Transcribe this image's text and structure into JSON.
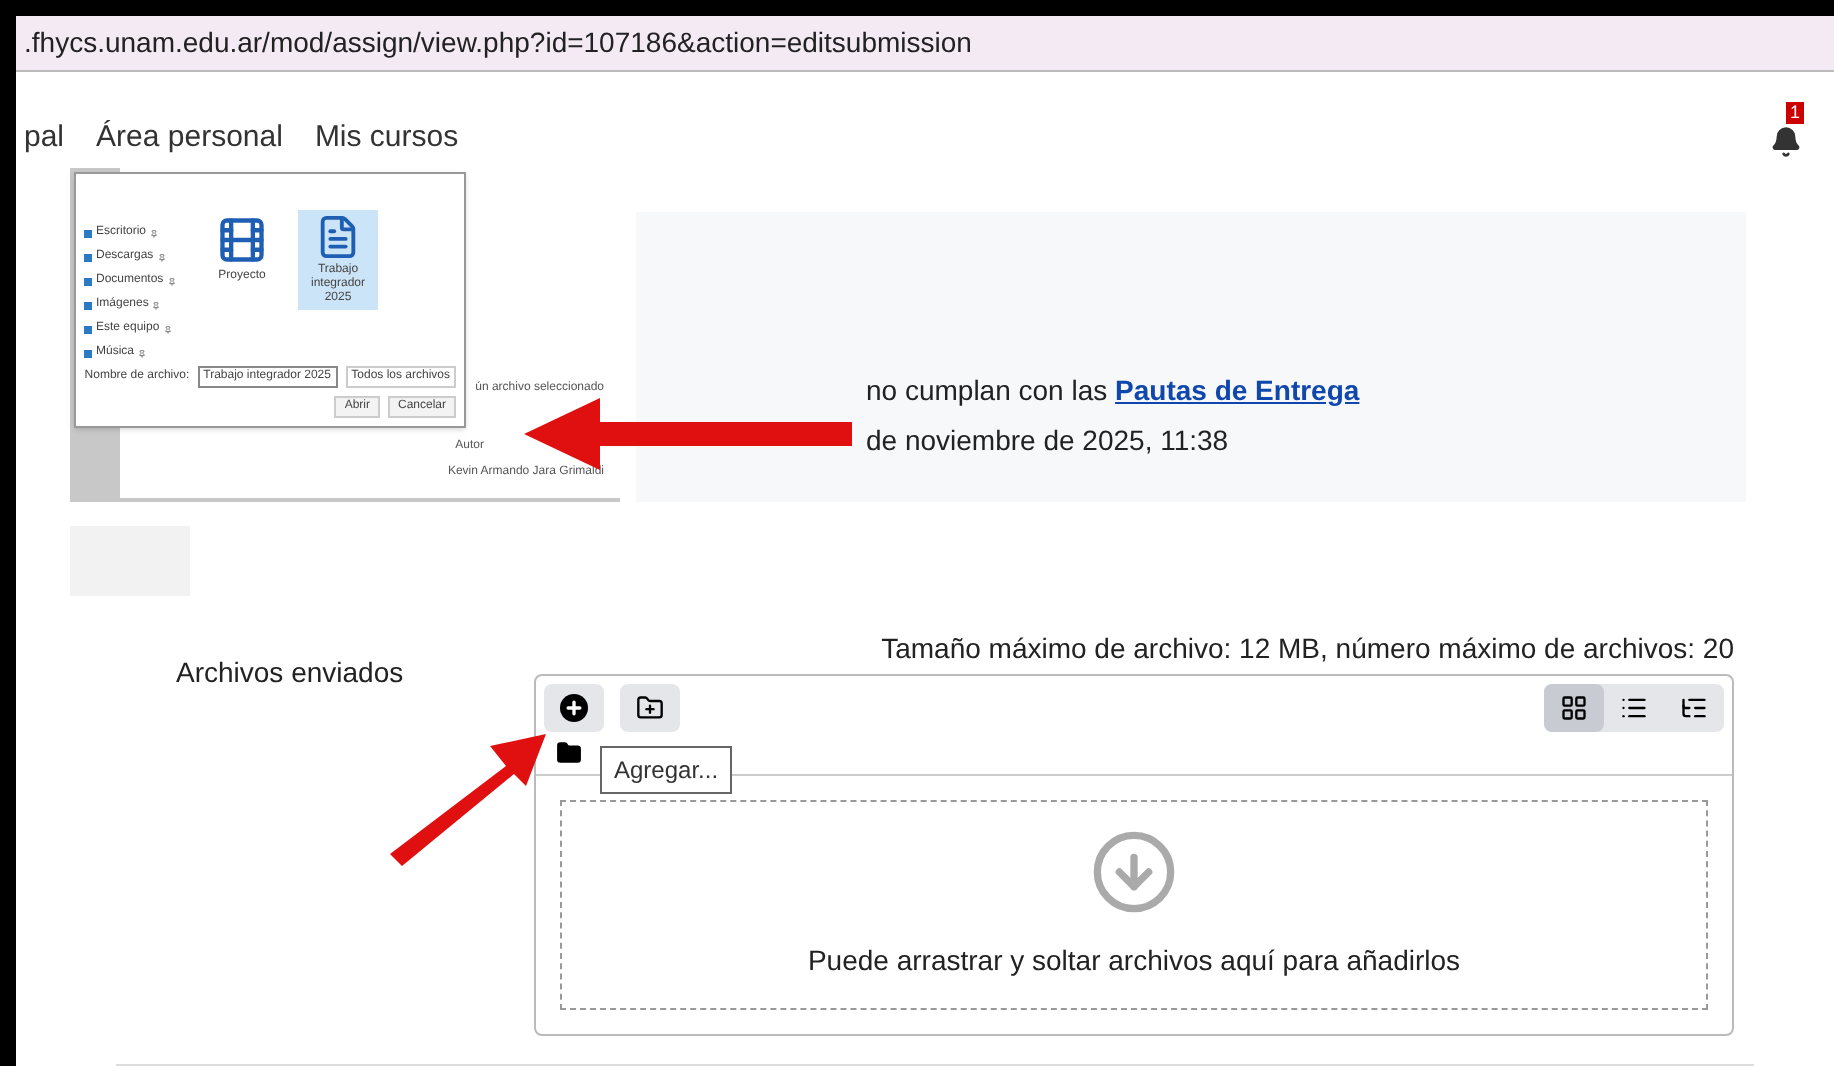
{
  "address_bar": {
    "url": ".fhycs.unam.edu.ar/mod/assign/view.php?id=107186&action=editsubmission"
  },
  "nav": {
    "items": [
      "pal",
      "Área personal",
      "Mis cursos"
    ],
    "notifications": "1"
  },
  "file_dialog": {
    "sidebar": [
      "Escritorio",
      "Descargas",
      "Documentos",
      "Imágenes",
      "Este equipo",
      "Música"
    ],
    "files": [
      {
        "kind": "video",
        "name": "Proyecto",
        "selected": false
      },
      {
        "kind": "word",
        "name": "Trabajo integrador 2025",
        "selected": true
      }
    ],
    "filename_label": "Nombre de archivo:",
    "filename": "Trabajo integrador 2025",
    "filter": "Todos los archivos",
    "buttons": [
      "Abrir",
      "Cancelar"
    ]
  },
  "background_panel": {
    "status": "ún archivo seleccionado",
    "author_label": "Autor",
    "author": "Kevin Armando Jara Grimaldi"
  },
  "notice": {
    "text": "no cumplan con las **Pautas de Entrega**",
    "date": "de noviembre de 2025, 11:38"
  },
  "submission": {
    "label": "Archivos enviados",
    "limits": "Tamaño máximo de archivo: 12 MB, número máximo de archivos: 20",
    "views": [
      {
        "kind": "grid",
        "selected": true
      },
      {
        "kind": "list",
        "selected": false
      },
      {
        "kind": "tree",
        "selected": false
      }
    ],
    "tooltip": "Agregar...",
    "dropzone": "Puede arrastrar y soltar archivos aquí para añadirlos"
  }
}
